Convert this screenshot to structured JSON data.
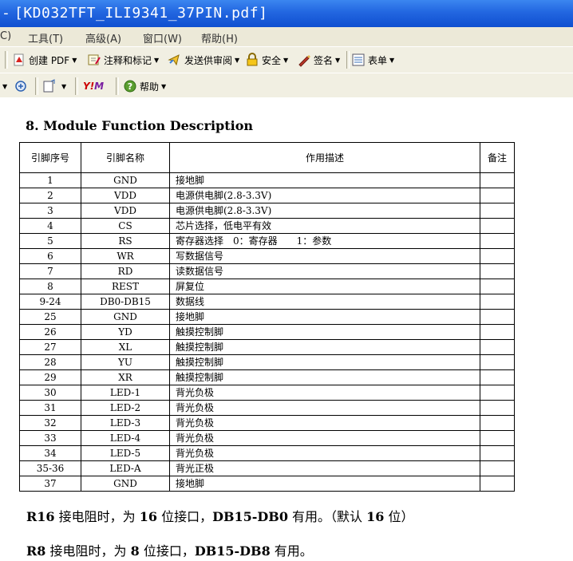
{
  "window": {
    "dash": "-",
    "title": "[KD032TFT_ILI9341_37PIN.pdf]"
  },
  "menu": [
    "C)",
    "工具(T)",
    "高级(A)",
    "窗口(W)",
    "帮助(H)"
  ],
  "toolbar1": {
    "create_pdf": "创建 PDF",
    "comment_markup": "注释和标记",
    "send_review": "发送供审阅",
    "security": "安全",
    "sign": "签名",
    "forms": "表单"
  },
  "toolbar2": {
    "help": "帮助"
  },
  "doc": {
    "heading": "8. Module Function Description",
    "headers": [
      "引脚序号",
      "引脚名称",
      "作用描述",
      "备注"
    ],
    "rows": [
      [
        "1",
        "GND",
        "接地脚",
        ""
      ],
      [
        "2",
        "VDD",
        "电源供电脚(2.8-3.3V)",
        ""
      ],
      [
        "3",
        "VDD",
        "电源供电脚(2.8-3.3V)",
        ""
      ],
      [
        "4",
        "CS",
        "芯片选择，低电平有效",
        ""
      ],
      [
        "5",
        "RS",
        "寄存器选择　0：寄存器　　1：参数",
        ""
      ],
      [
        "6",
        "WR",
        "写数据信号",
        ""
      ],
      [
        "7",
        "RD",
        "读数据信号",
        ""
      ],
      [
        "8",
        "REST",
        "屏复位",
        ""
      ],
      [
        "9-24",
        "DB0-DB15",
        "数据线",
        ""
      ],
      [
        "25",
        "GND",
        "接地脚",
        ""
      ],
      [
        "26",
        "YD",
        "触摸控制脚",
        ""
      ],
      [
        "27",
        "XL",
        "触摸控制脚",
        ""
      ],
      [
        "28",
        "YU",
        "触摸控制脚",
        ""
      ],
      [
        "29",
        "XR",
        "触摸控制脚",
        ""
      ],
      [
        "30",
        "LED-1",
        "背光负极",
        ""
      ],
      [
        "31",
        "LED-2",
        "背光负极",
        ""
      ],
      [
        "32",
        "LED-3",
        "背光负极",
        ""
      ],
      [
        "33",
        "LED-4",
        "背光负极",
        ""
      ],
      [
        "34",
        "LED-5",
        "背光负极",
        ""
      ],
      [
        "35-36",
        "LED-A",
        "背光正极",
        ""
      ],
      [
        "37",
        "GND",
        "接地脚",
        ""
      ]
    ],
    "note1": {
      "a": "R16",
      "b": " 接电阻时，为 ",
      "c": "16",
      "d": " 位接口，",
      "e": "DB15-DB0",
      "f": " 有用。（默认 ",
      "g": "16",
      "h": " 位）"
    },
    "note2": {
      "a": "R8",
      "b": " 接电阻时，为 ",
      "c": "8",
      "d": " 位接口，",
      "e": "DB15-DB8",
      "f": " 有用。"
    }
  }
}
